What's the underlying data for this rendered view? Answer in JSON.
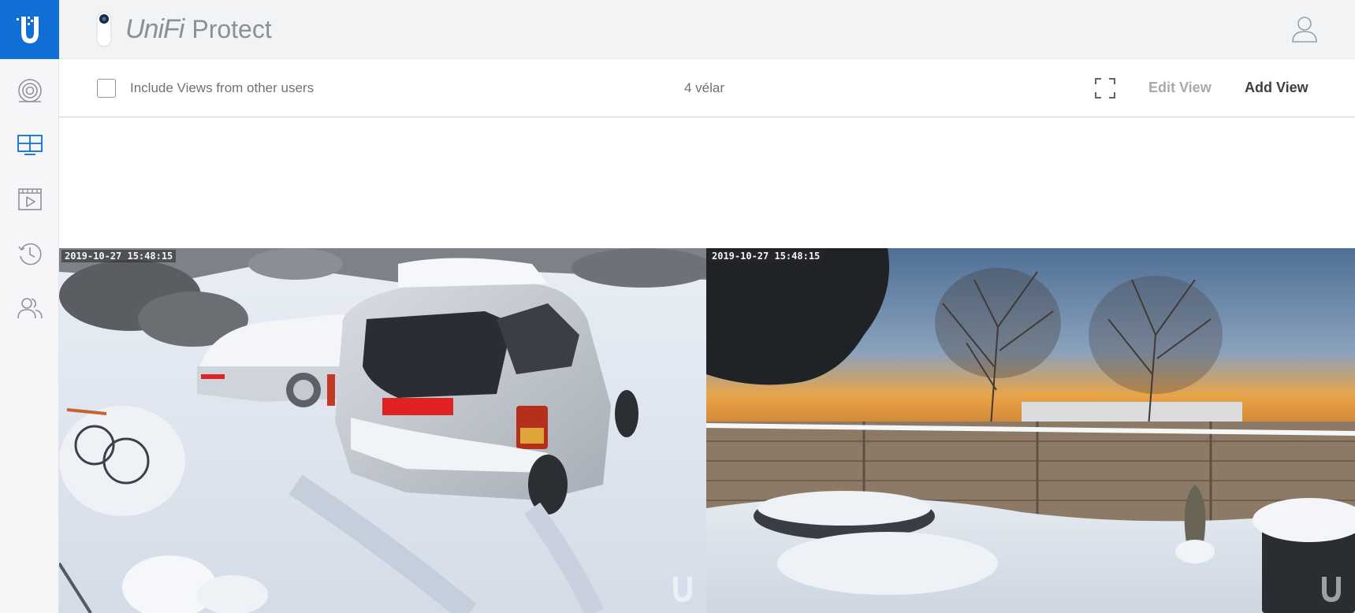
{
  "app": {
    "brand_unifi": "UniFi",
    "brand_product": "Protect"
  },
  "sidebar": {
    "items": [
      {
        "name": "cameras",
        "icon": "camera-icon",
        "active": false
      },
      {
        "name": "liveview",
        "icon": "grid-icon",
        "active": true
      },
      {
        "name": "recordings",
        "icon": "play-icon",
        "active": false
      },
      {
        "name": "history",
        "icon": "history-icon",
        "active": false
      },
      {
        "name": "users",
        "icon": "users-icon",
        "active": false
      }
    ]
  },
  "toolbar": {
    "include_label": "Include Views from other users",
    "include_checked": false,
    "view_name": "4 vélar",
    "edit_label": "Edit View",
    "add_label": "Add View"
  },
  "feeds": [
    {
      "timestamp": "2019-10-27 15:48:15"
    },
    {
      "timestamp": "2019-10-27 15:48:15"
    }
  ],
  "colors": {
    "accent": "#0f6fd6",
    "sidebar_bg": "#f6f6f8",
    "header_bg": "#f2f3f5"
  }
}
